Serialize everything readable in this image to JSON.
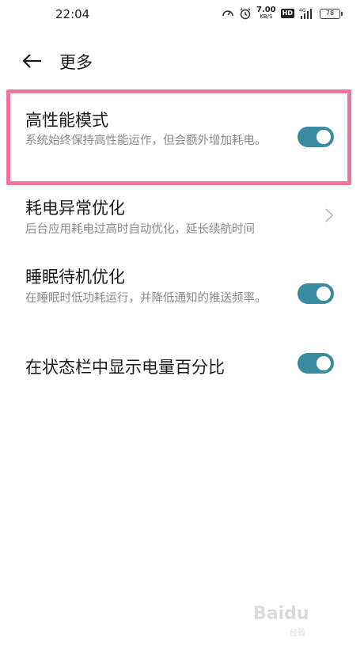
{
  "status_bar": {
    "time": "22:04",
    "speed_value": "7.00",
    "speed_unit": "KB/S",
    "hd_label": "HD",
    "network_label": "4G",
    "battery": "78",
    "icons": [
      "speed-gauge-icon",
      "alarm-icon",
      "hd-icon",
      "signal-icon",
      "battery-icon"
    ]
  },
  "header": {
    "back_icon": "arrow-left-icon",
    "title": "更多"
  },
  "settings": [
    {
      "title": "高性能模式",
      "description": "系统始终保持高性能运作，但会额外增加耗电。",
      "control": "toggle",
      "enabled": true
    },
    {
      "title": "耗电异常优化",
      "description": "后台应用耗电过高时自动优化，延长续航时间",
      "control": "chevron"
    },
    {
      "title": "睡眠待机优化",
      "description": "在睡眠时低功耗运行，并降低通知的推送频率。",
      "control": "toggle",
      "enabled": true
    },
    {
      "title": "在状态栏中显示电量百分比",
      "description": "",
      "control": "toggle",
      "enabled": true
    }
  ],
  "colors": {
    "toggle_on": "#3a8aa0",
    "highlight": "#f0749c",
    "description": "#8a8a8a"
  },
  "watermark": {
    "text": "Baidu",
    "sub": "经验"
  }
}
